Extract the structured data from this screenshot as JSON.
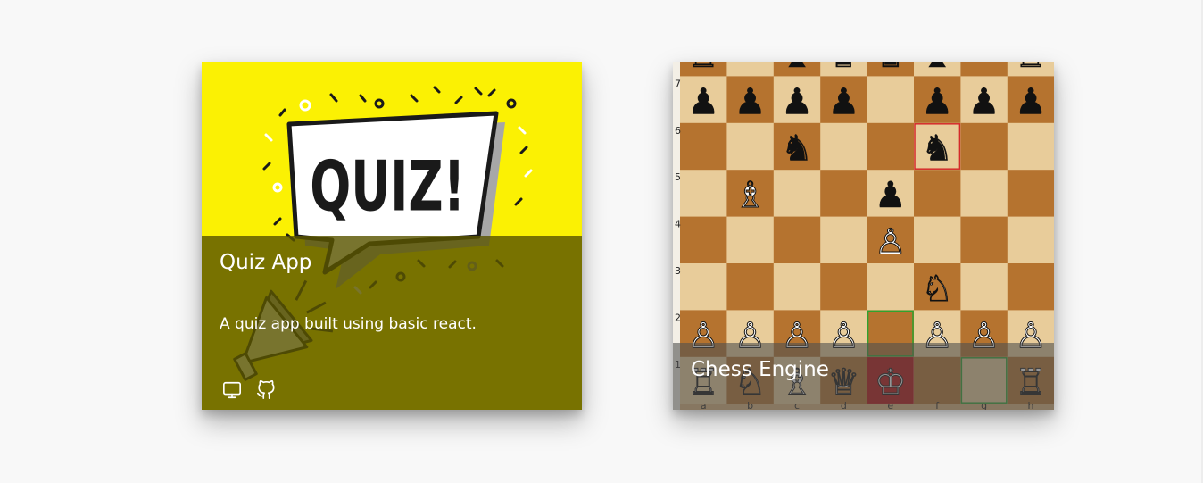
{
  "cards": [
    {
      "id": "quiz",
      "title": "Quiz App",
      "description": "A quiz app built using basic react.",
      "art_text": "QUIZ!",
      "links": [
        {
          "icon": "desktop-icon"
        },
        {
          "icon": "github-icon"
        }
      ],
      "colors": {
        "background": "#fbf103",
        "overlay": "#5a5600"
      }
    },
    {
      "id": "chess",
      "title": "Chess Engine",
      "board": {
        "ranks": [
          "7",
          "6",
          "5",
          "4",
          "3",
          "2",
          "1"
        ],
        "files": [
          "a",
          "b",
          "c",
          "d",
          "e",
          "f",
          "g",
          "h"
        ],
        "pieces": [
          {
            "square": "a8",
            "glyph": "♜"
          },
          {
            "square": "c8",
            "glyph": "♝"
          },
          {
            "square": "d8",
            "glyph": "♛"
          },
          {
            "square": "e8",
            "glyph": "♚"
          },
          {
            "square": "f8",
            "glyph": "♝"
          },
          {
            "square": "h8",
            "glyph": "♜"
          },
          {
            "square": "a7",
            "glyph": "♟"
          },
          {
            "square": "b7",
            "glyph": "♟"
          },
          {
            "square": "c7",
            "glyph": "♟"
          },
          {
            "square": "d7",
            "glyph": "♟"
          },
          {
            "square": "f7",
            "glyph": "♟"
          },
          {
            "square": "g7",
            "glyph": "♟"
          },
          {
            "square": "h7",
            "glyph": "♟"
          },
          {
            "square": "c6",
            "glyph": "♞"
          },
          {
            "square": "f6",
            "glyph": "♞"
          },
          {
            "square": "b5",
            "glyph": "♗"
          },
          {
            "square": "e5",
            "glyph": "♟"
          },
          {
            "square": "e4",
            "glyph": "♙"
          },
          {
            "square": "f3",
            "glyph": "♘"
          },
          {
            "square": "a2",
            "glyph": "♙"
          },
          {
            "square": "b2",
            "glyph": "♙"
          },
          {
            "square": "c2",
            "glyph": "♙"
          },
          {
            "square": "d2",
            "glyph": "♙"
          },
          {
            "square": "f2",
            "glyph": "♙"
          },
          {
            "square": "g2",
            "glyph": "♙"
          },
          {
            "square": "h2",
            "glyph": "♙"
          },
          {
            "square": "a1",
            "glyph": "♖"
          },
          {
            "square": "b1",
            "glyph": "♘"
          },
          {
            "square": "c1",
            "glyph": "♗"
          },
          {
            "square": "d1",
            "glyph": "♕"
          },
          {
            "square": "e1",
            "glyph": "♔"
          },
          {
            "square": "h1",
            "glyph": "♖"
          }
        ],
        "highlights": [
          {
            "square": "f6",
            "color": "#d42a2a"
          },
          {
            "square": "e2",
            "color": "#2fa32f"
          },
          {
            "square": "g1",
            "color": "#2fa32f"
          },
          {
            "square": "e1",
            "color": "#b50d0d",
            "fill": true
          }
        ]
      }
    }
  ]
}
